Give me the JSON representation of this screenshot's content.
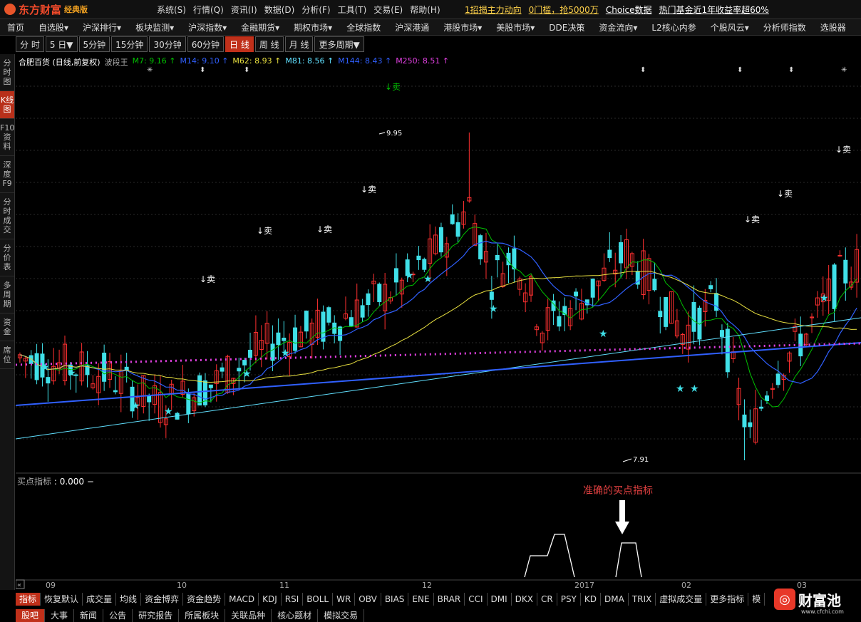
{
  "app": {
    "brand": "东方财富",
    "edition": "经典版"
  },
  "menu": [
    "系统(S)",
    "行情(Q)",
    "资讯(I)",
    "数据(D)",
    "分析(F)",
    "工具(T)",
    "交易(E)",
    "帮助(H)"
  ],
  "promos": [
    "1招揭主力动向",
    "0门槛，抢5000万",
    "Choice数据",
    "热门基金近1年收益率超60%"
  ],
  "nav": [
    "首页",
    "自选股▾",
    "沪深排行▾",
    "板块监测▾",
    "沪深指数▾",
    "金融期货▾",
    "期权市场▾",
    "全球指数",
    "沪深港通",
    "港股市场▾",
    "美股市场▾",
    "DDE决策",
    "资金流向▾",
    "L2核心内参",
    "个股风云▾",
    "分析师指数",
    "选股器"
  ],
  "sidebar": [
    "分时图",
    "K线图",
    "F10资料",
    "深度F9",
    "分时成交",
    "分价表",
    "多周期",
    "资金",
    "席位"
  ],
  "periods": [
    "分 时",
    "5 日▼",
    "5分钟",
    "15分钟",
    "30分钟",
    "60分钟",
    "日 线",
    "周 线",
    "月 线",
    "更多周期▼"
  ],
  "chart_title": "合肥百货 (日线,前复权)",
  "wave_label": "波段王",
  "ma": [
    {
      "name": "M7",
      "value": "9.16",
      "color": "#00c000"
    },
    {
      "name": "M14",
      "value": "9.10",
      "color": "#3060ff"
    },
    {
      "name": "M62",
      "value": "8.93",
      "color": "#e8e040"
    },
    {
      "name": "M81",
      "value": "8.56",
      "color": "#60e0ff"
    },
    {
      "name": "M144",
      "value": "8.43",
      "color": "#3060ff"
    },
    {
      "name": "M250",
      "value": "8.51",
      "color": "#e040e0"
    }
  ],
  "price_high": "9.95",
  "price_low": "7.91",
  "sell_label": "↓卖",
  "indicator": {
    "name": "买点指标",
    "value": ": 0.000 −"
  },
  "annotation": "准确的买点指标",
  "x_labels": [
    "09",
    "10",
    "11",
    "12",
    "2017",
    "02",
    "03"
  ],
  "bottom_tabs": [
    "指标",
    "恢复默认",
    "成交量",
    "均线",
    "资金博弈",
    "资金趋势",
    "MACD",
    "KDJ",
    "RSI",
    "BOLL",
    "WR",
    "OBV",
    "BIAS",
    "ENE",
    "BRAR",
    "CCI",
    "DMI",
    "DKX",
    "CR",
    "PSY",
    "KD",
    "DMA",
    "TRIX",
    "虚拟成交量",
    "更多指标",
    "模"
  ],
  "bottom_tabs2": [
    "股吧",
    "大事",
    "新闻",
    "公告",
    "研究报告",
    "所属板块",
    "关联品种",
    "核心题材",
    "模拟交易"
  ],
  "watermark": {
    "name": "财富池",
    "url": "www.cfchi.com"
  },
  "colors": {
    "up": "#ff3030",
    "down": "#40e0e8",
    "accent": "#c0301a"
  }
}
